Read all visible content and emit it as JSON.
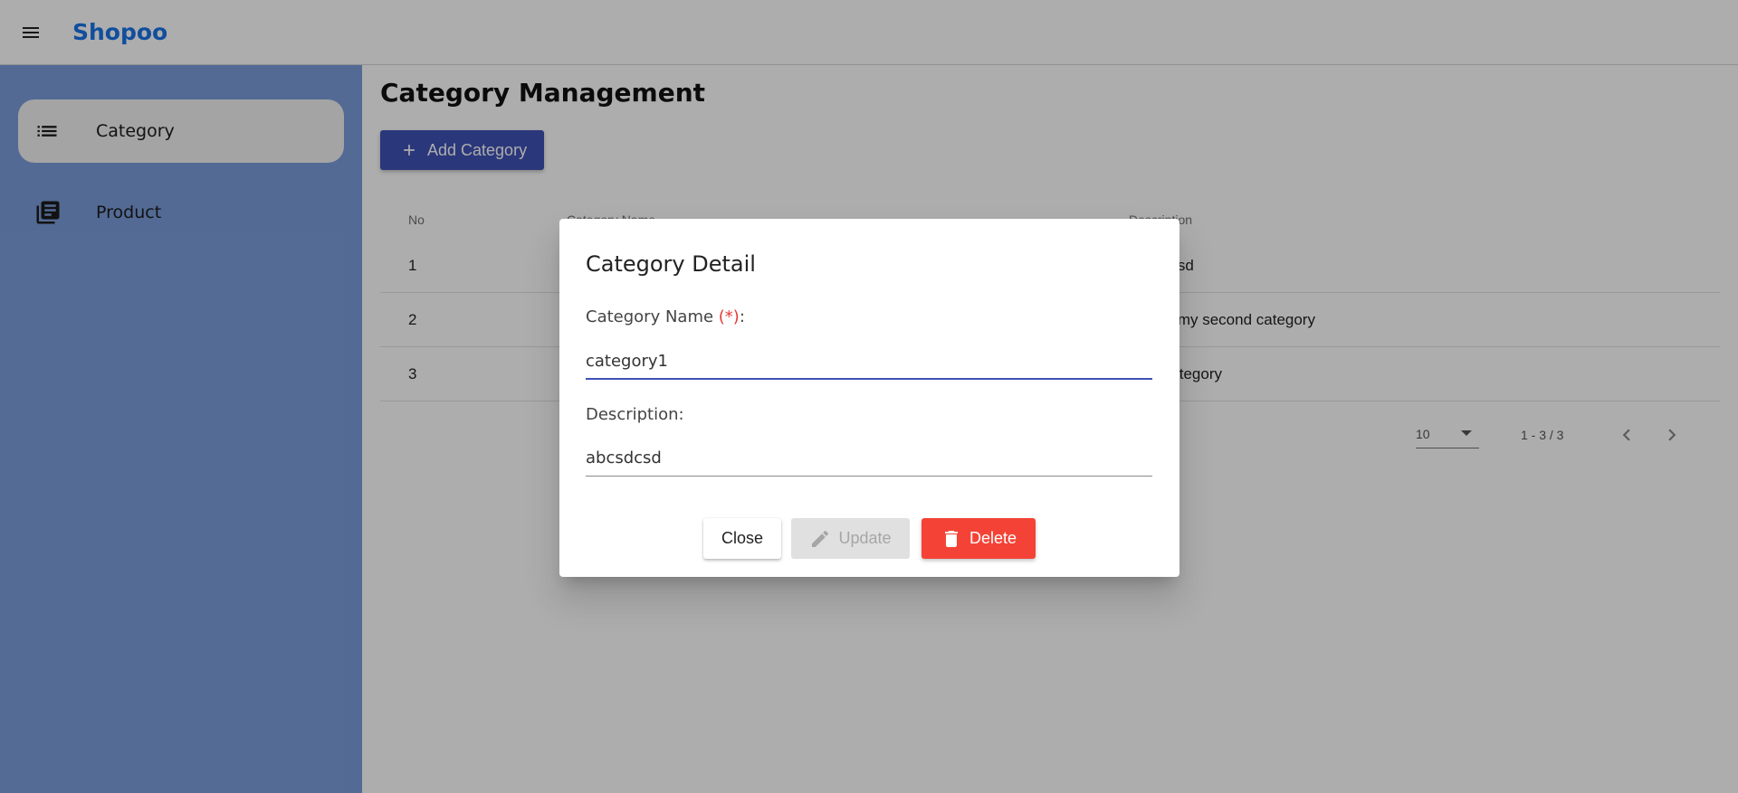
{
  "app": {
    "brand": "Shopoo"
  },
  "sidebar": {
    "items": [
      {
        "label": "Category",
        "icon": "list-icon",
        "active": true
      },
      {
        "label": "Product",
        "icon": "library-books-icon",
        "active": false
      }
    ]
  },
  "main": {
    "title": "Category Management",
    "add_button_label": "Add Category",
    "table": {
      "headers": [
        "No",
        "Category Name",
        "Description"
      ],
      "rows": [
        {
          "no": "1",
          "name": "",
          "description": "abcsdcsd"
        },
        {
          "no": "2",
          "name": "",
          "description": "This is my second category"
        },
        {
          "no": "3",
          "name": "",
          "description": "third category"
        }
      ]
    },
    "paginator": {
      "page_size": "10",
      "range": "1 - 3 / 3"
    }
  },
  "dialog": {
    "title": "Category Detail",
    "name_label": "Category Name ",
    "name_required_mark": "(*)",
    "name_label_suffix": ":",
    "name_value": "category1",
    "description_label": "Description:",
    "description_value": "abcsdcsd",
    "close_label": "Close",
    "update_label": "Update",
    "delete_label": "Delete"
  },
  "colors": {
    "primary": "#3f51b5",
    "brand": "#1a73e8",
    "sidebar": "#7b9ddb",
    "danger": "#f44336"
  }
}
